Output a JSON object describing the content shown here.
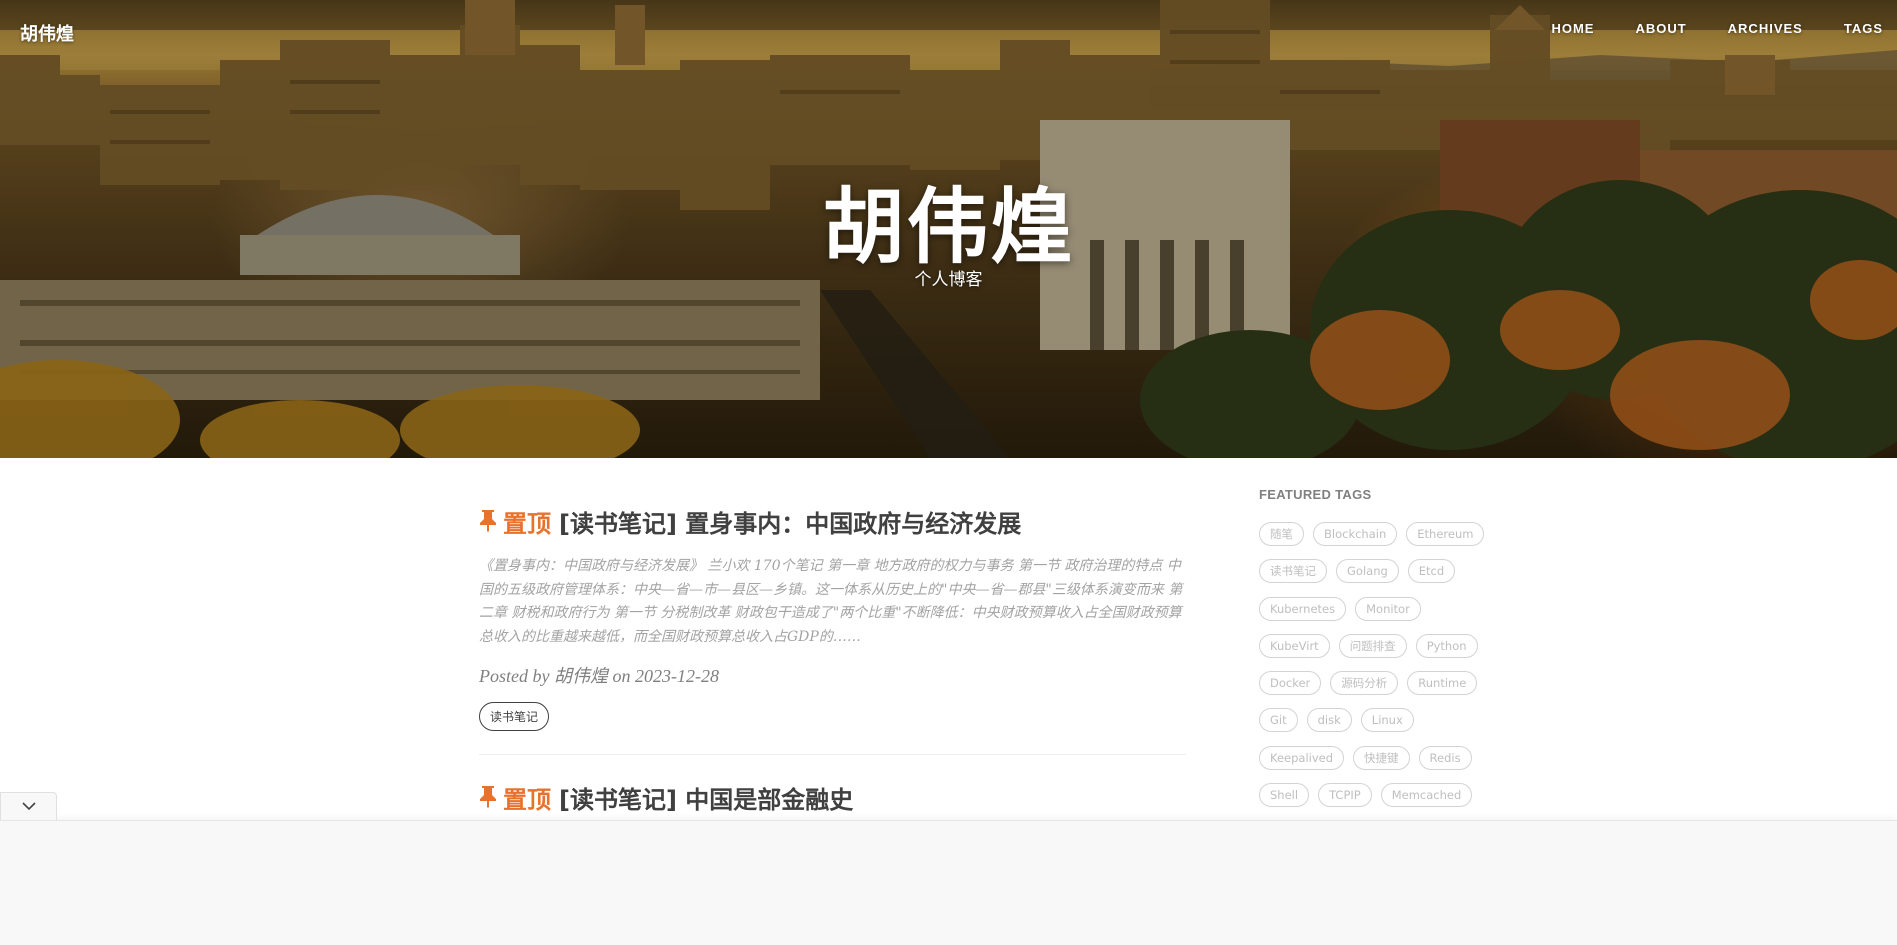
{
  "nav": {
    "brand": "胡伟煌",
    "links": [
      "HOME",
      "ABOUT",
      "ARCHIVES",
      "TAGS"
    ]
  },
  "hero": {
    "title": "胡伟煌",
    "subtitle": "个人博客"
  },
  "posts": [
    {
      "pin_label": "置顶",
      "title": "[读书笔记] 置身事内：中国政府与经济发展",
      "excerpt": "《置身事内：中国政府与经济发展》 兰小欢 170个笔记 第一章 地方政府的权力与事务 第一节 政府治理的特点 中国的五级政府管理体系：中央—省—市—县区—乡镇。这一体系从历史上的\"中央—省—郡县\"三级体系演变而来 第二章 财税和政府行为 第一节 分税制改革 财政包干造成了\"两个比重\"不断降低：中央财政预算收入占全国财政预算总收入的比重越来越低，而全国财政预算总收入占GDP的……",
      "meta_prefix": "Posted by ",
      "author": "胡伟煌",
      "meta_on": " on ",
      "date": "2023-12-28",
      "tag": "读书笔记"
    },
    {
      "pin_label": "置顶",
      "title": "[读书笔记] 中国是部金融史"
    }
  ],
  "sidebar": {
    "title": "FEATURED TAGS",
    "tags": [
      "随笔",
      "Blockchain",
      "Ethereum",
      "读书笔记",
      "Golang",
      "Etcd",
      "Kubernetes",
      "Monitor",
      "KubeVirt",
      "问题排查",
      "Python",
      "Docker",
      "源码分析",
      "Runtime",
      "Git",
      "disk",
      "Linux",
      "Keepalived",
      "快捷键",
      "Redis",
      "Shell",
      "TCPIP",
      "Memcached"
    ]
  },
  "icons": {
    "pin": "pushpin-icon",
    "panel_toggle": "chevron-down-icon"
  },
  "colors": {
    "accent": "#e8722c",
    "text": "#404040",
    "muted": "#a3a3a3"
  }
}
